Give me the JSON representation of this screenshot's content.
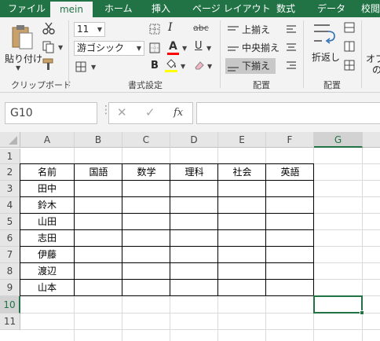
{
  "tabs": [
    {
      "label": "ファイル",
      "active": false
    },
    {
      "label": "mein",
      "active": true
    },
    {
      "label": "ホーム",
      "active": false
    },
    {
      "label": "挿入",
      "active": false
    },
    {
      "label": "ページ レイアウト",
      "active": false
    },
    {
      "label": "数式",
      "active": false
    },
    {
      "label": "データ",
      "active": false
    },
    {
      "label": "校閲",
      "active": false
    }
  ],
  "ribbon": {
    "clipboard": {
      "paste_label": "貼り付け",
      "group_label": "クリップボード"
    },
    "font": {
      "size": "11",
      "name": "游ゴシック",
      "bold": "B",
      "italic": "I",
      "underline": "U",
      "color_letter": "A",
      "strike": "abc",
      "group_label": "書式設定",
      "font_color": "#ff0000",
      "fill_color": "#ffff00"
    },
    "align": {
      "top_label": "上揃え",
      "middle_label": "中央揃え",
      "bottom_label": "下揃え",
      "group_label": "配置"
    },
    "wrap": {
      "label": "折返し",
      "group_label": "配置"
    },
    "options": {
      "label_line1": "オプ",
      "label_line2": "の"
    }
  },
  "formula_bar": {
    "name_box": "G10",
    "cancel": "✕",
    "enter": "✓",
    "fx": "fx",
    "value": ""
  },
  "grid": {
    "columns": [
      "A",
      "B",
      "C",
      "D",
      "E",
      "F",
      "G"
    ],
    "rows": [
      "1",
      "2",
      "3",
      "4",
      "5",
      "6",
      "7",
      "8",
      "9",
      "10",
      "11"
    ],
    "selected_column": "G",
    "selected_row": "10",
    "header_row": [
      "名前",
      "国語",
      "数学",
      "理科",
      "社会",
      "英語"
    ],
    "names": [
      "田中",
      "鈴木",
      "山田",
      "志田",
      "伊藤",
      "渡辺",
      "山本"
    ]
  },
  "colors": {
    "accent": "#217346"
  }
}
